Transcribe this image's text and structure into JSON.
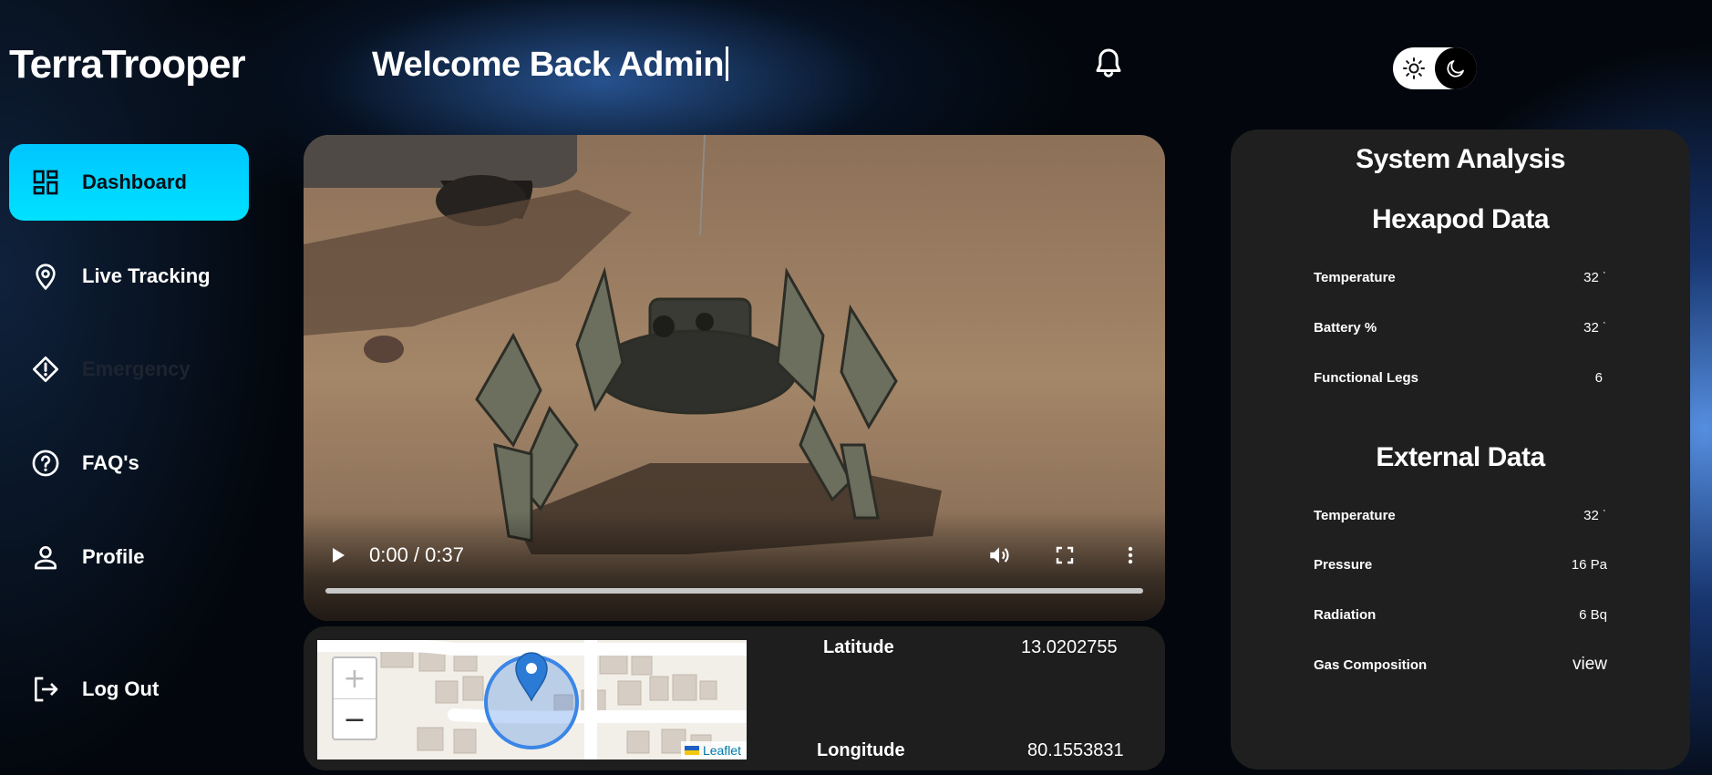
{
  "app": {
    "brand": "TerraTrooper"
  },
  "header": {
    "welcome": "Welcome Back Admin",
    "notification_icon": "bell-icon",
    "theme_toggle": {
      "light_icon": "sun-icon",
      "dark_icon": "moon-icon",
      "mode": "dark"
    }
  },
  "sidebar": {
    "items": [
      {
        "label": "Dashboard",
        "icon": "dashboard-icon",
        "active": true
      },
      {
        "label": "Live Tracking",
        "icon": "location-pin-icon"
      },
      {
        "label": "Emergency",
        "icon": "warning-diamond-icon"
      },
      {
        "label": "FAQ's",
        "icon": "help-circle-icon"
      },
      {
        "label": "Profile",
        "icon": "person-icon"
      }
    ],
    "logout": {
      "label": "Log Out",
      "icon": "logout-icon"
    }
  },
  "video": {
    "time": "0:00 / 0:37",
    "progress": 0,
    "controls": [
      "play-icon",
      "volume-icon",
      "fullscreen-icon",
      "more-options-icon"
    ]
  },
  "location": {
    "latitude_label": "Latitude",
    "latitude": "13.0202755",
    "longitude_label": "Longitude",
    "longitude": "80.1553831",
    "map": {
      "zoom_in": "+",
      "zoom_out": "−",
      "attribution": "Leaflet"
    }
  },
  "analysis": {
    "title": "System Analysis",
    "hexapod": {
      "title": "Hexapod Data",
      "rows": [
        {
          "label": "Temperature",
          "value": "32 ˙"
        },
        {
          "label": "Battery %",
          "value": "32 ˙"
        },
        {
          "label": "Functional Legs",
          "value": "6"
        }
      ]
    },
    "external": {
      "title": "External Data",
      "rows": [
        {
          "label": "Temperature",
          "value": "32 ˙"
        },
        {
          "label": "Pressure",
          "value": "16 Pa"
        },
        {
          "label": "Radiation",
          "value": "6 Bq"
        },
        {
          "label": "Gas Composition",
          "value": "view"
        }
      ]
    }
  },
  "colors": {
    "accent": "#00d4ff",
    "panel": "#1f1f1f",
    "background": "#03070d"
  }
}
